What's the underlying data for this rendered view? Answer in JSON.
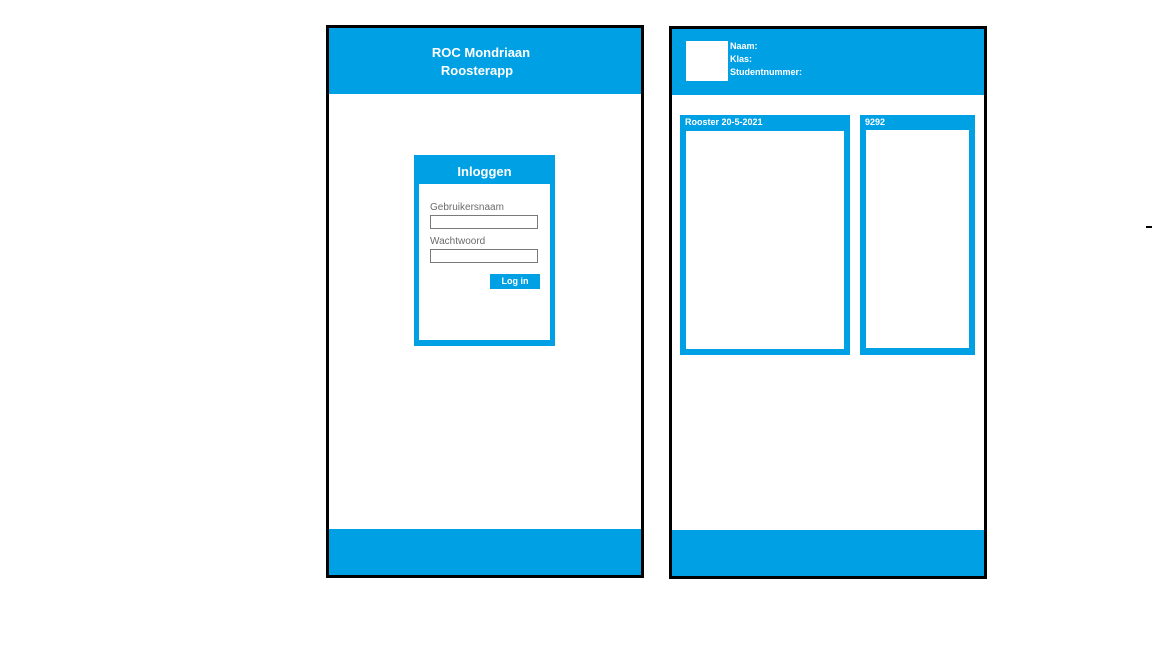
{
  "login_screen": {
    "title_line_1": "ROC Mondriaan",
    "title_line_2": "Roosterapp",
    "login": {
      "header": "Inloggen",
      "username_label": "Gebruikersnaam",
      "username_value": "",
      "password_label": "Wachtwoord",
      "password_value": "",
      "button_label": "Log in"
    }
  },
  "rooster_screen": {
    "profile": {
      "name_label": "Naam:",
      "class_label": "Klas:",
      "student_number_label": "Studentnummer:"
    },
    "schedule_panel": {
      "title": "Rooster 20-5-2021"
    },
    "code_panel": {
      "title": "9292"
    }
  },
  "colors": {
    "accent": "#00a0e5",
    "frame": "#000000",
    "background": "#ffffff"
  }
}
